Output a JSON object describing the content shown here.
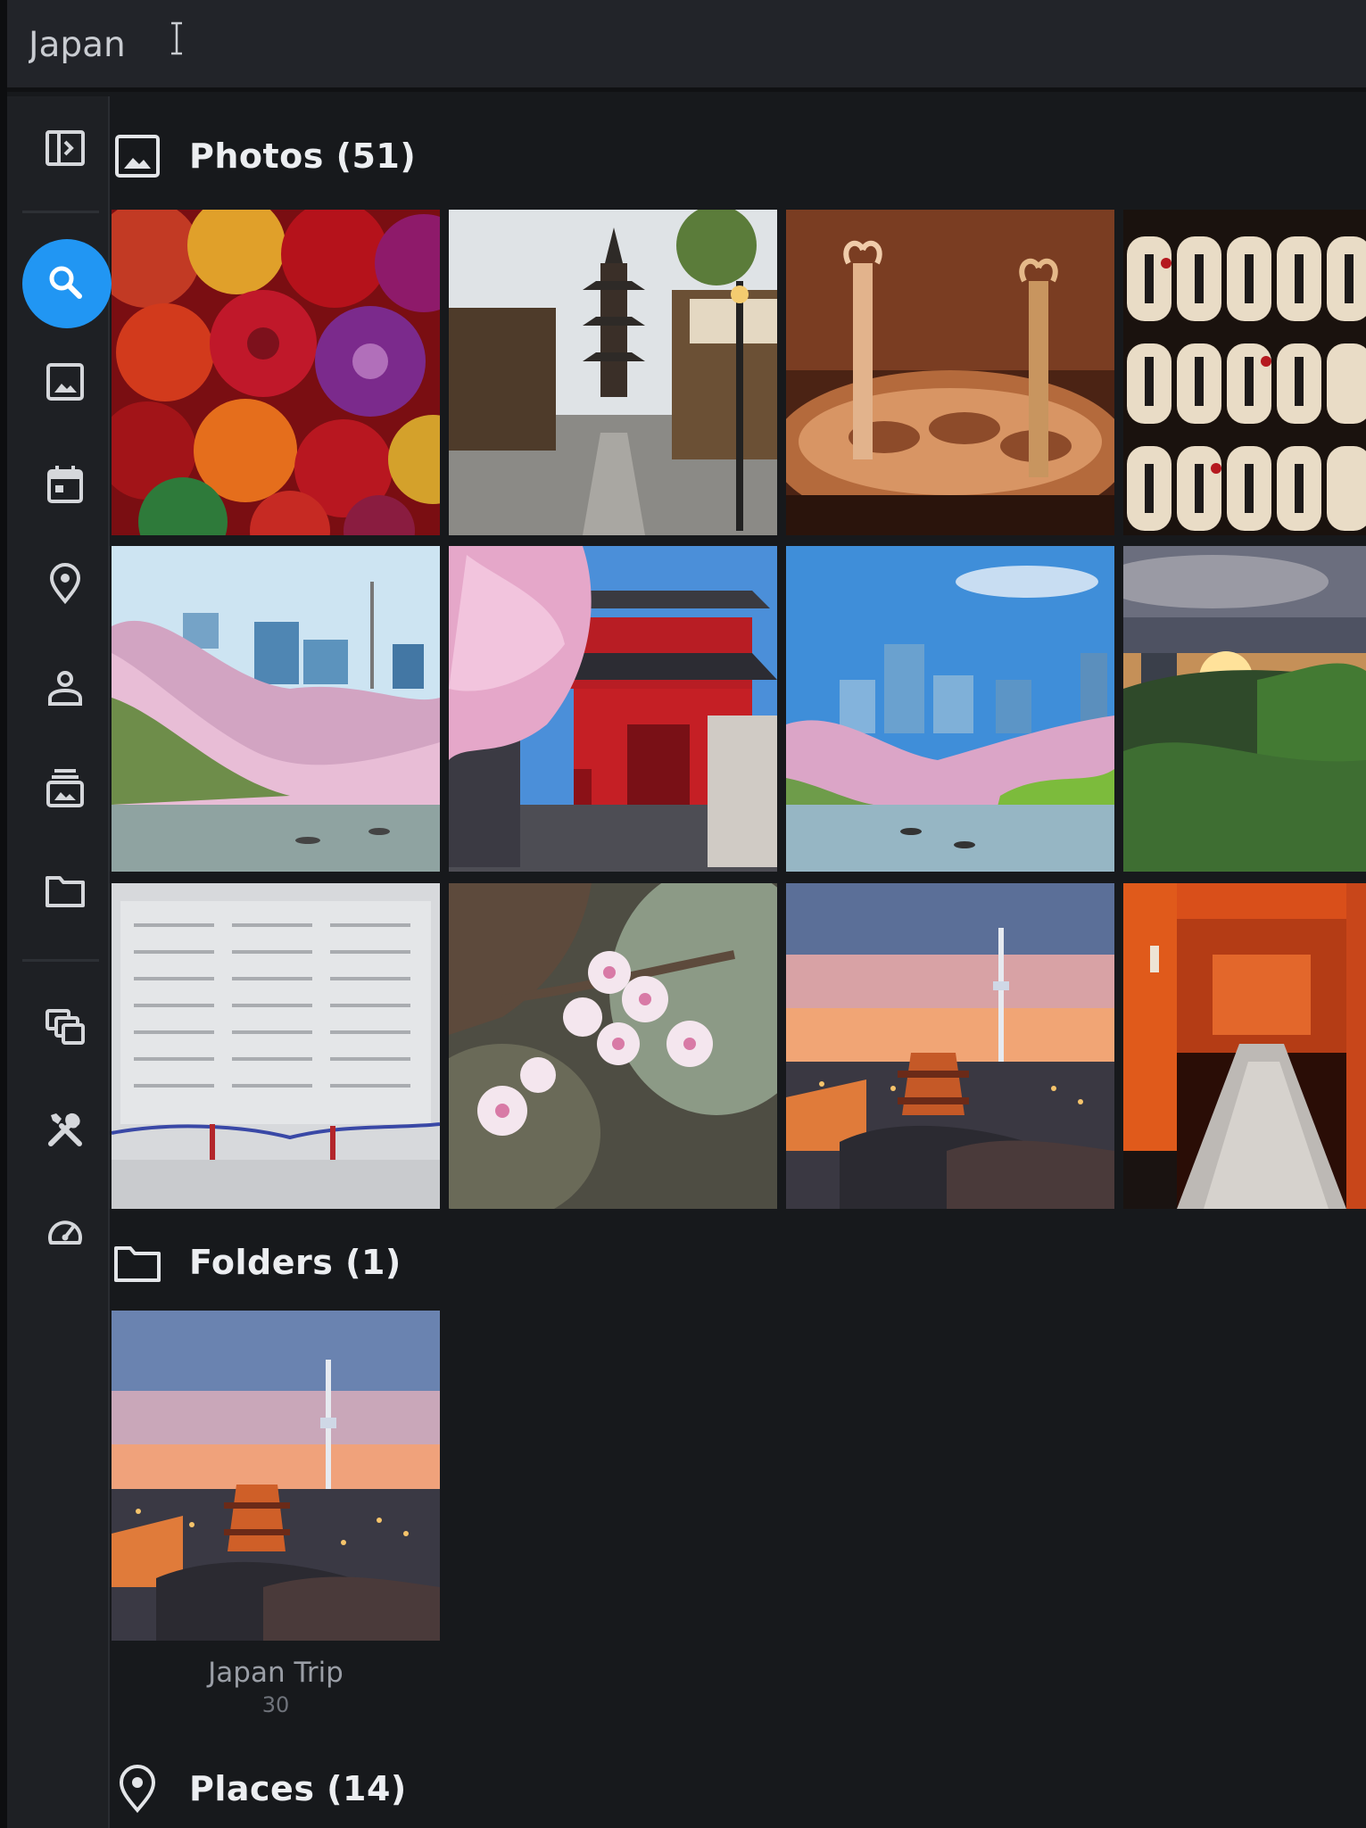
{
  "search": {
    "value": "Japan"
  },
  "sidebar": {
    "items": [
      {
        "name": "toggle-sidebar",
        "icon": "sidebar-toggle-icon",
        "active": false
      },
      {
        "name": "search",
        "icon": "search-icon",
        "active": true
      },
      {
        "name": "photos",
        "icon": "image-icon",
        "active": false
      },
      {
        "name": "calendar",
        "icon": "calendar-icon",
        "active": false
      },
      {
        "name": "places",
        "icon": "map-pin-icon",
        "active": false
      },
      {
        "name": "people",
        "icon": "person-icon",
        "active": false
      },
      {
        "name": "albums",
        "icon": "album-icon",
        "active": false
      },
      {
        "name": "folders",
        "icon": "folder-icon",
        "active": false
      },
      {
        "name": "duplicates",
        "icon": "stacked-images-icon",
        "active": false
      },
      {
        "name": "tools",
        "icon": "tools-icon",
        "active": false
      },
      {
        "name": "dashboard",
        "icon": "gauge-icon",
        "active": false
      }
    ]
  },
  "sections": {
    "photos": {
      "title": "Photos (51)",
      "icon": "image-icon"
    },
    "folders": {
      "title": "Folders (1)",
      "icon": "folder-icon"
    },
    "places": {
      "title": "Places (14)",
      "icon": "map-pin-icon"
    }
  },
  "photos": [
    {
      "subject": "parasols"
    },
    {
      "subject": "pagoda-street"
    },
    {
      "subject": "copper-pot"
    },
    {
      "subject": "lanterns"
    },
    {
      "subject": "cherry-blossom-river"
    },
    {
      "subject": "red-temple-gate"
    },
    {
      "subject": "river-skyline"
    },
    {
      "subject": "sunset-park"
    },
    {
      "subject": "memorial-wall"
    },
    {
      "subject": "sakura-branch"
    },
    {
      "subject": "tokyo-skytree-dusk"
    },
    {
      "subject": "torii-tunnel"
    }
  ],
  "folders": [
    {
      "name": "Japan Trip",
      "count": "30"
    }
  ],
  "colors": {
    "accent": "#2196f3",
    "background": "#17191c",
    "sidebar": "#1e2024",
    "topbar": "#222429"
  }
}
